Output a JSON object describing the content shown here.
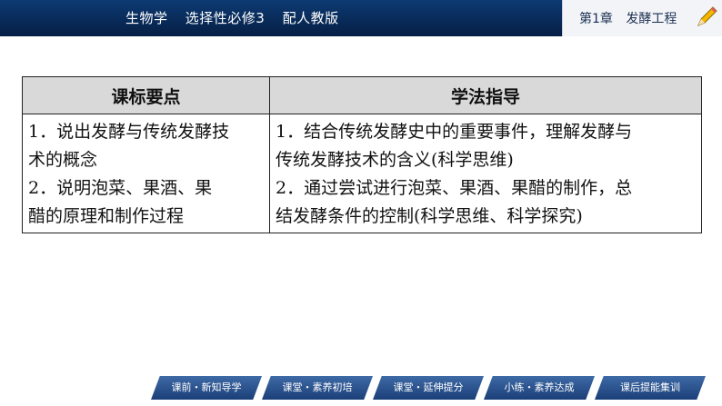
{
  "header": {
    "subject": "生物学",
    "volume": "选择性必修3",
    "publisher": "配人教版",
    "chapter": "第1章",
    "chapter_title": "发酵工程"
  },
  "table": {
    "headers": [
      "课标要点",
      "学法指导"
    ],
    "rows": [
      {
        "left": [
          "1．说出发酵与传统发酵技",
          "术的概念",
          "2．说明泡菜、果酒、果",
          "醋的原理和制作过程"
        ],
        "right": [
          "1．结合传统发酵史中的重要事件，理解发酵与",
          "传统发酵技术的含义(科学思维)",
          "2．通过尝试进行泡菜、果酒、果醋的制作，总",
          "结发酵条件的控制(科学思维、科学探究)"
        ]
      }
    ]
  },
  "nav": {
    "items": [
      "课前・新知导学",
      "课堂・素养初培",
      "课堂・延伸提分",
      "小练・素养达成",
      "课后提能集训"
    ]
  },
  "colors": {
    "header_bg": "#0d3a73",
    "nav_bg": "#2a5391",
    "table_header_bg": "#d9d9d9"
  }
}
